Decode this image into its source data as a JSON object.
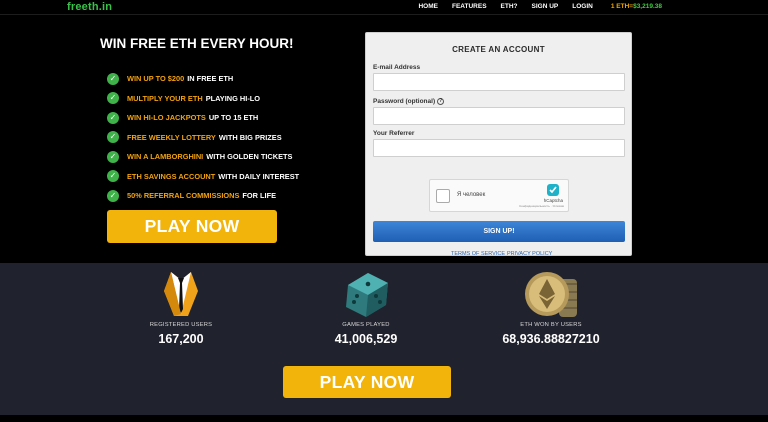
{
  "nav": {
    "logo_main": "freeth",
    "logo_tld": ".in",
    "links": [
      "HOME",
      "FEATURES",
      "ETH?",
      "SIGN UP",
      "LOGIN"
    ],
    "price_eth": "1 ETH",
    "price_eq": "=",
    "price_value": "$3,219.38"
  },
  "hero": {
    "title": "WIN FREE ETH EVERY HOUR!",
    "features": [
      {
        "highlight": "WIN UP TO $200",
        "rest": "IN FREE ETH"
      },
      {
        "highlight": "MULTIPLY YOUR ETH",
        "rest": "PLAYING HI-LO"
      },
      {
        "highlight": "WIN HI-LO JACKPOTS",
        "rest": "UP TO 15 ETH"
      },
      {
        "highlight": "FREE WEEKLY LOTTERY",
        "rest": "WITH BIG PRIZES"
      },
      {
        "highlight": "WIN A LAMBORGHINI",
        "rest": "WITH GOLDEN TICKETS"
      },
      {
        "highlight": "ETH SAVINGS ACCOUNT",
        "rest": "WITH DAILY INTEREST"
      },
      {
        "highlight": "50% REFERRAL COMMISSIONS",
        "rest": "FOR LIFE"
      }
    ],
    "play_label": "PLAY NOW"
  },
  "signup": {
    "title": "CREATE AN ACCOUNT",
    "email_label": "E-mail Address",
    "password_label": "Password (optional)",
    "password_help": "?",
    "referrer_label": "Your Referrer",
    "captcha_text": "Я человек",
    "captcha_brand": "hCaptcha",
    "captcha_small": "Конфиденциальность · Условия",
    "submit_label": "SIGN UP!",
    "terms_label": "TERMS OF SERVICE",
    "privacy_label": "PRIVACY POLICY"
  },
  "stats": {
    "registered_label": "REGISTERED USERS",
    "registered_value": "167,200",
    "games_label": "GAMES PLAYED",
    "games_value": "41,006,529",
    "eth_label": "ETH WON BY USERS",
    "eth_value": "68,936.88827210",
    "play_label": "PLAY NOW",
    "icons": [
      "suit-icon",
      "dice-icon",
      "eth-coins-icon"
    ]
  },
  "colors": {
    "brand_green": "#39c24a",
    "accent_orange": "#f2a20d",
    "button_yellow": "#f2b40a",
    "signup_blue": "#2a6fc6",
    "stats_bg": "#20222d"
  }
}
